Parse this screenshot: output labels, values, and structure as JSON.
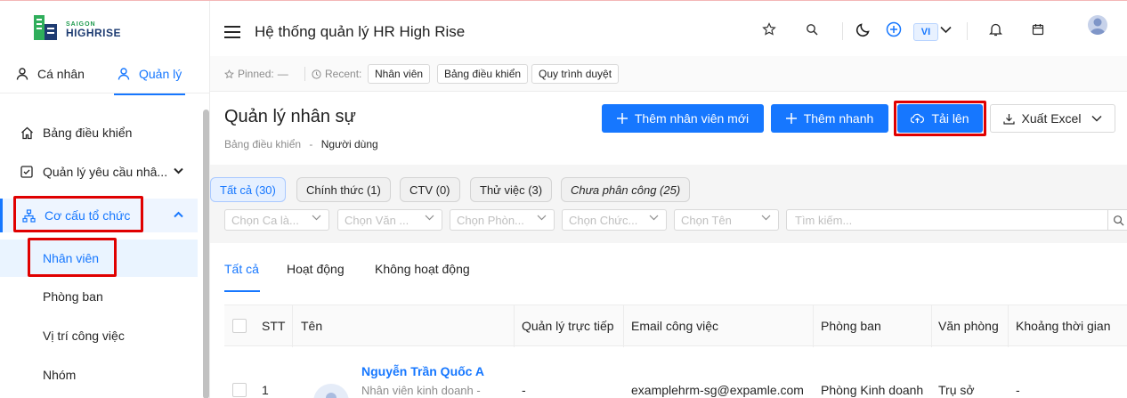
{
  "brand": {
    "logo_top": "SAIGON",
    "logo_bottom": "HIGHRISE",
    "logo_icon": "building-logo-icon"
  },
  "header": {
    "title": "Hệ thống quản lý HR High Rise",
    "lang": "VI",
    "icons": [
      "menu-icon",
      "star-icon",
      "search-icon",
      "moon-icon",
      "plus-circle-icon",
      "chevron-down-icon",
      "bell-icon",
      "calendar-icon",
      "avatar"
    ]
  },
  "sidebar": {
    "mode_tabs": {
      "personal": "Cá nhân",
      "manage": "Quản lý"
    },
    "items": {
      "dashboard": "Bảng điều khiển",
      "requests": "Quản lý yêu cầu nhâ...",
      "org": "Cơ cấu tổ chức"
    },
    "sub_items": {
      "employees": "Nhân viên",
      "departments": "Phòng ban",
      "positions": "Vị trí công việc",
      "groups": "Nhóm"
    }
  },
  "pinbar": {
    "pinned_label": "Pinned:",
    "pinned_value": "—",
    "recent_label": "Recent:",
    "recent": [
      "Nhân viên",
      "Bảng điều khiển",
      "Quy trình duyệt"
    ]
  },
  "page": {
    "title": "Quản lý nhân sự",
    "breadcrumb_parent": "Bảng điều khiển",
    "breadcrumb_sep": "-",
    "breadcrumb_current": "Người dùng",
    "buttons": {
      "add_employee": "Thêm nhân viên mới",
      "quick_add": "Thêm nhanh",
      "upload": "Tải lên",
      "export": "Xuất Excel"
    }
  },
  "status_filters": [
    "Tất cả (30)",
    "Chính thức (1)",
    "CTV (0)",
    "Thử việc (3)",
    "Chưa phân công (25)"
  ],
  "selects": [
    "Chọn Ca là...",
    "Chọn Văn ...",
    "Chọn Phòn...",
    "Chọn Chức...",
    "Chọn Tên"
  ],
  "search": {
    "placeholder": "Tìm kiếm..."
  },
  "sub_tabs": [
    "Tất cả",
    "Hoạt động",
    "Không hoạt động"
  ],
  "table": {
    "columns": [
      "STT",
      "Tên",
      "Quản lý trực tiếp",
      "Email công việc",
      "Phòng ban",
      "Văn phòng",
      "Khoảng thời gian"
    ],
    "rows": [
      {
        "stt": "1",
        "name": "Nguyễn Trần Quốc A",
        "role": "Nhân viên kinh doanh -",
        "manager": "-",
        "email": "examplehrm-sg@expamle.com",
        "department": "Phòng Kinh doanh",
        "office": "Trụ sở",
        "period": "-"
      }
    ]
  },
  "colors": {
    "accent": "#1677ff",
    "highlight": "#e00000"
  }
}
